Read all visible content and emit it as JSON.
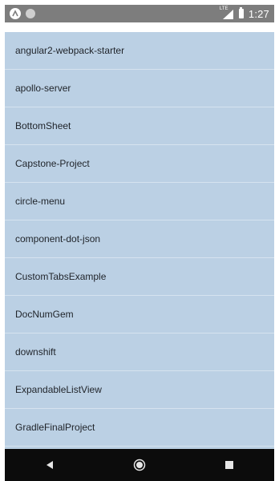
{
  "status_bar": {
    "network_label": "LTE",
    "time": "1:27"
  },
  "list": {
    "items": [
      {
        "label": "angular2-webpack-starter"
      },
      {
        "label": "apollo-server"
      },
      {
        "label": "BottomSheet"
      },
      {
        "label": "Capstone-Project"
      },
      {
        "label": "circle-menu"
      },
      {
        "label": "component-dot-json"
      },
      {
        "label": "CustomTabsExample"
      },
      {
        "label": "DocNumGem"
      },
      {
        "label": "downshift"
      },
      {
        "label": "ExpandableListView"
      },
      {
        "label": "GradleFinalProject"
      }
    ]
  },
  "nav_bar": {
    "icons": [
      "back-icon",
      "home-icon",
      "recents-icon"
    ]
  },
  "colors": {
    "status_bar": "#7d7d7d",
    "list_background": "#bbd0e4",
    "nav_bar": "#0c0c0c"
  }
}
